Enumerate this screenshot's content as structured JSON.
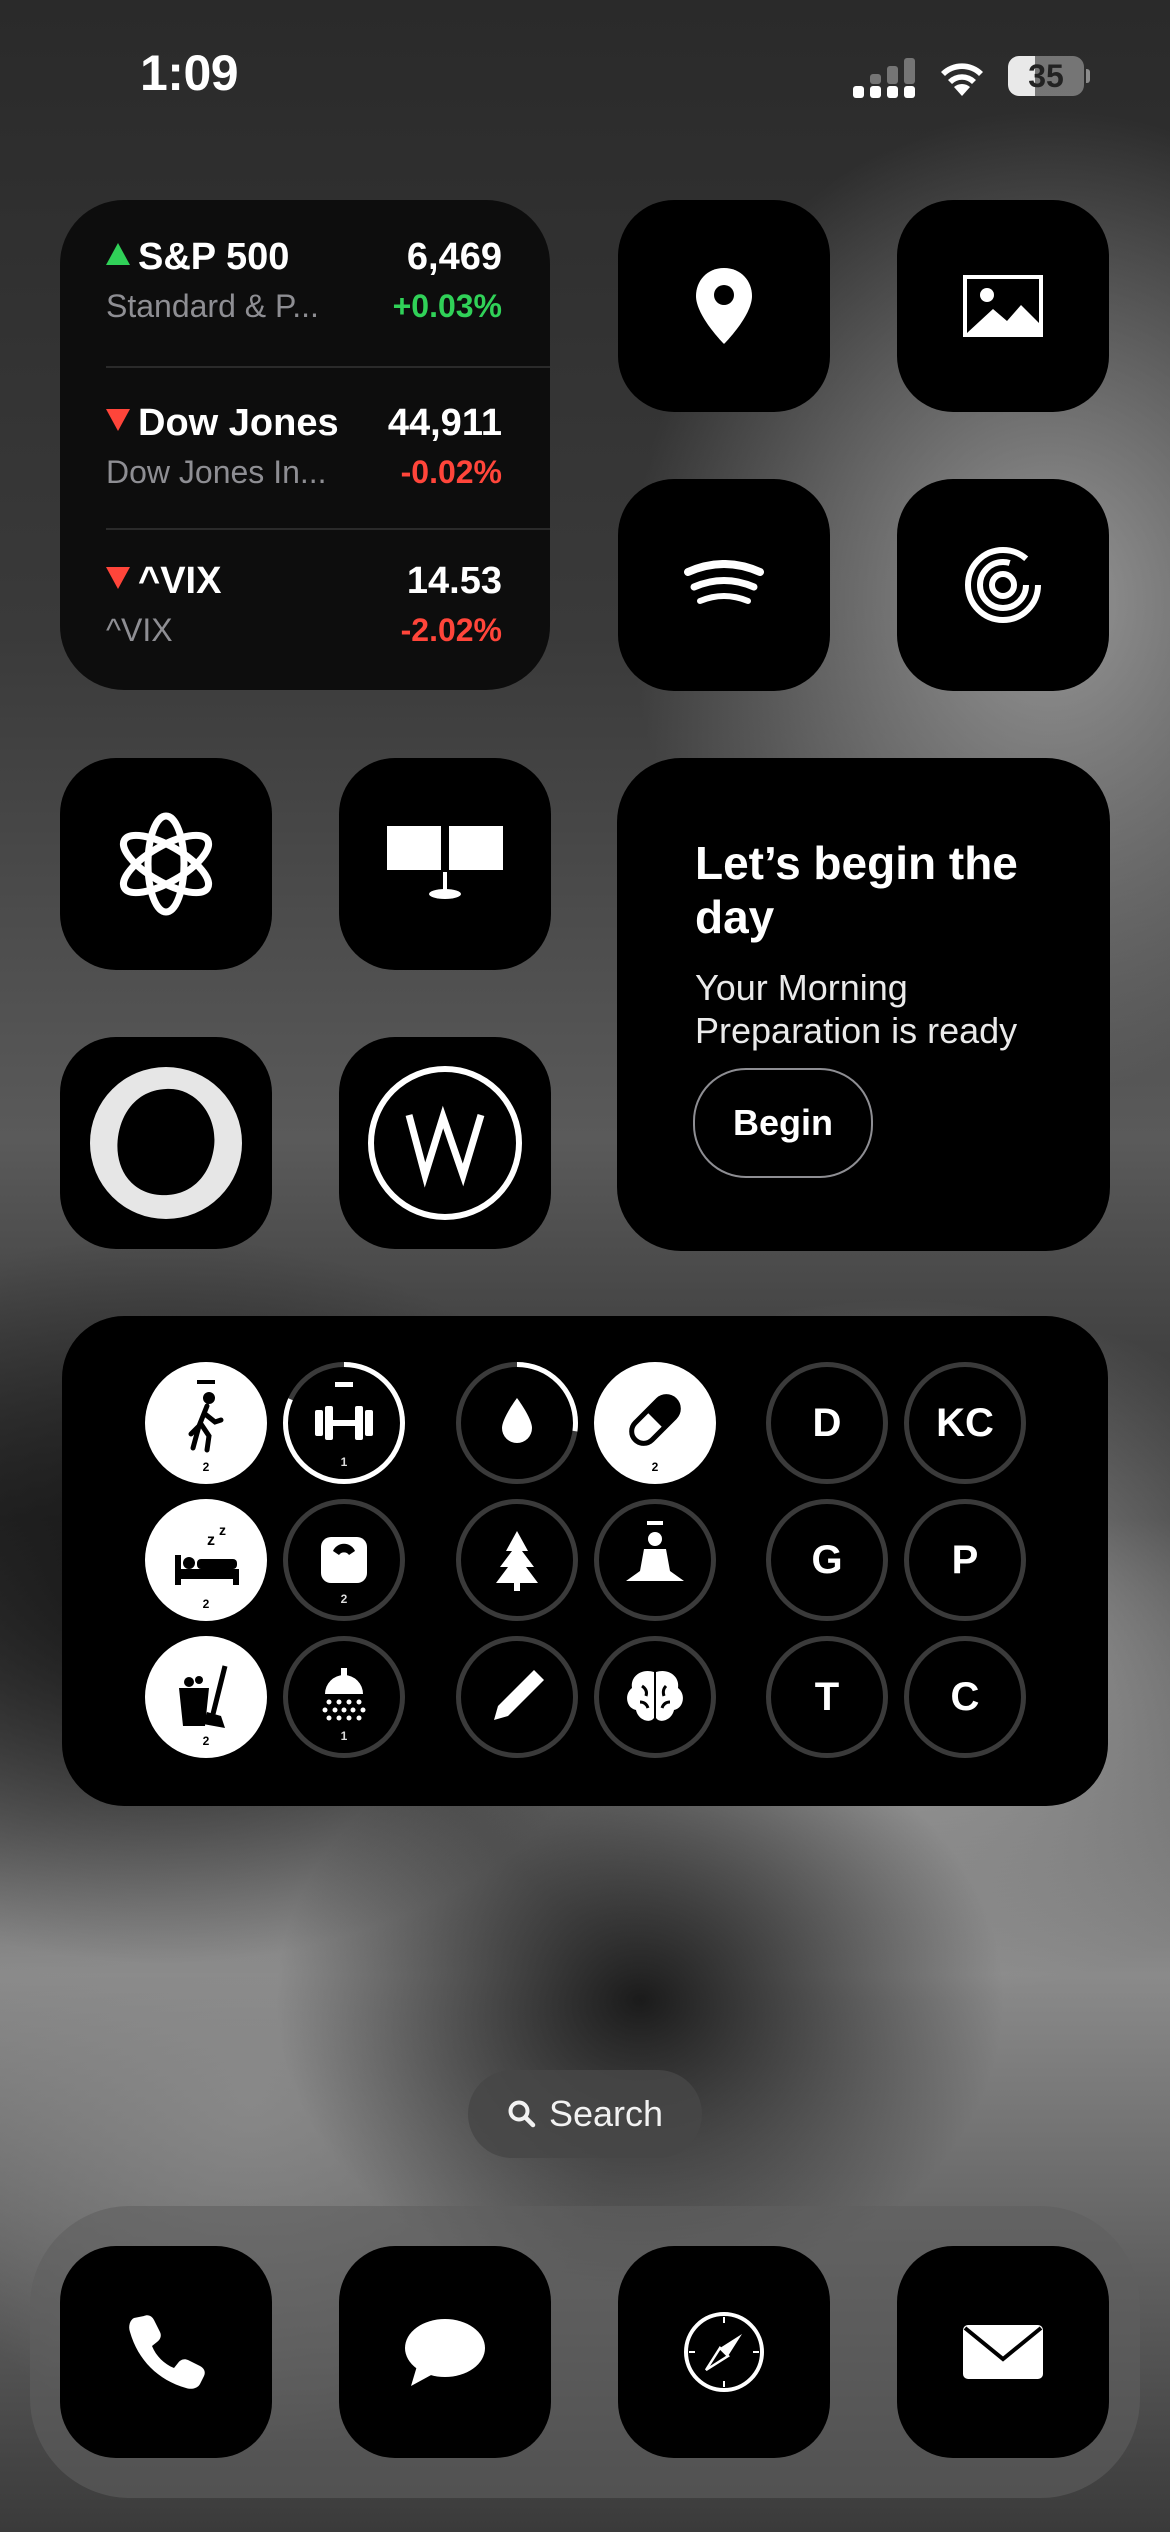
{
  "status_bar": {
    "time": "1:09",
    "battery_percent": "35",
    "battery_level": 0.35
  },
  "stocks_widget": {
    "rows": [
      {
        "symbol": "S&P 500",
        "full_name": "Standard & P...",
        "price": "6,469",
        "change": "+0.03%",
        "direction": "up"
      },
      {
        "symbol": "Dow Jones",
        "full_name": "Dow Jones In...",
        "price": "44,911",
        "change": "-0.02%",
        "direction": "down"
      },
      {
        "symbol": "^VIX",
        "full_name": "^VIX",
        "price": "14.53",
        "change": "-2.02%",
        "direction": "down"
      }
    ],
    "colors": {
      "up": "#30d158",
      "down": "#ff453a"
    }
  },
  "apps": [
    {
      "id": "maps",
      "icon": "location-pin-icon"
    },
    {
      "id": "photos",
      "icon": "image-icon"
    },
    {
      "id": "spotify",
      "icon": "spotify-icon"
    },
    {
      "id": "fitness",
      "icon": "activity-rings-icon"
    },
    {
      "id": "chatgpt",
      "icon": "openai-knot-icon"
    },
    {
      "id": "displays",
      "icon": "dual-monitor-icon"
    },
    {
      "id": "blob",
      "icon": "ring-blob-icon"
    },
    {
      "id": "w-app",
      "icon": "w-circle-icon"
    }
  ],
  "morning_widget": {
    "title": "Let’s begin the day",
    "subtitle": "Your Morning Preparation is ready",
    "button": "Begin"
  },
  "habits_widget": {
    "items": [
      {
        "icon": "walking-icon",
        "style": "filled",
        "count": "2"
      },
      {
        "icon": "dumbbell-icon",
        "style": "partial",
        "count": "1"
      },
      {
        "icon": "water-drop-icon",
        "style": "partial",
        "count": ""
      },
      {
        "icon": "pill-icon",
        "style": "filled",
        "count": "2"
      },
      {
        "icon": "sleep-bed-icon",
        "style": "filled",
        "count": "2"
      },
      {
        "icon": "scale-icon",
        "style": "outline",
        "count": "2"
      },
      {
        "icon": "tree-icon",
        "style": "outline",
        "count": ""
      },
      {
        "icon": "meditation-icon",
        "style": "outline",
        "count": ""
      },
      {
        "icon": "cleaning-icon",
        "style": "filled",
        "count": "2"
      },
      {
        "icon": "shower-icon",
        "style": "outline",
        "count": "1"
      },
      {
        "icon": "pen-icon",
        "style": "outline",
        "count": ""
      },
      {
        "icon": "brain-icon",
        "style": "outline",
        "count": ""
      }
    ],
    "letters": [
      "D",
      "KC",
      "G",
      "P",
      "T",
      "C"
    ]
  },
  "search": {
    "label": "Search"
  },
  "dock": [
    {
      "id": "phone",
      "icon": "phone-icon"
    },
    {
      "id": "messages",
      "icon": "message-bubble-icon"
    },
    {
      "id": "safari",
      "icon": "compass-icon"
    },
    {
      "id": "mail",
      "icon": "envelope-icon"
    }
  ]
}
